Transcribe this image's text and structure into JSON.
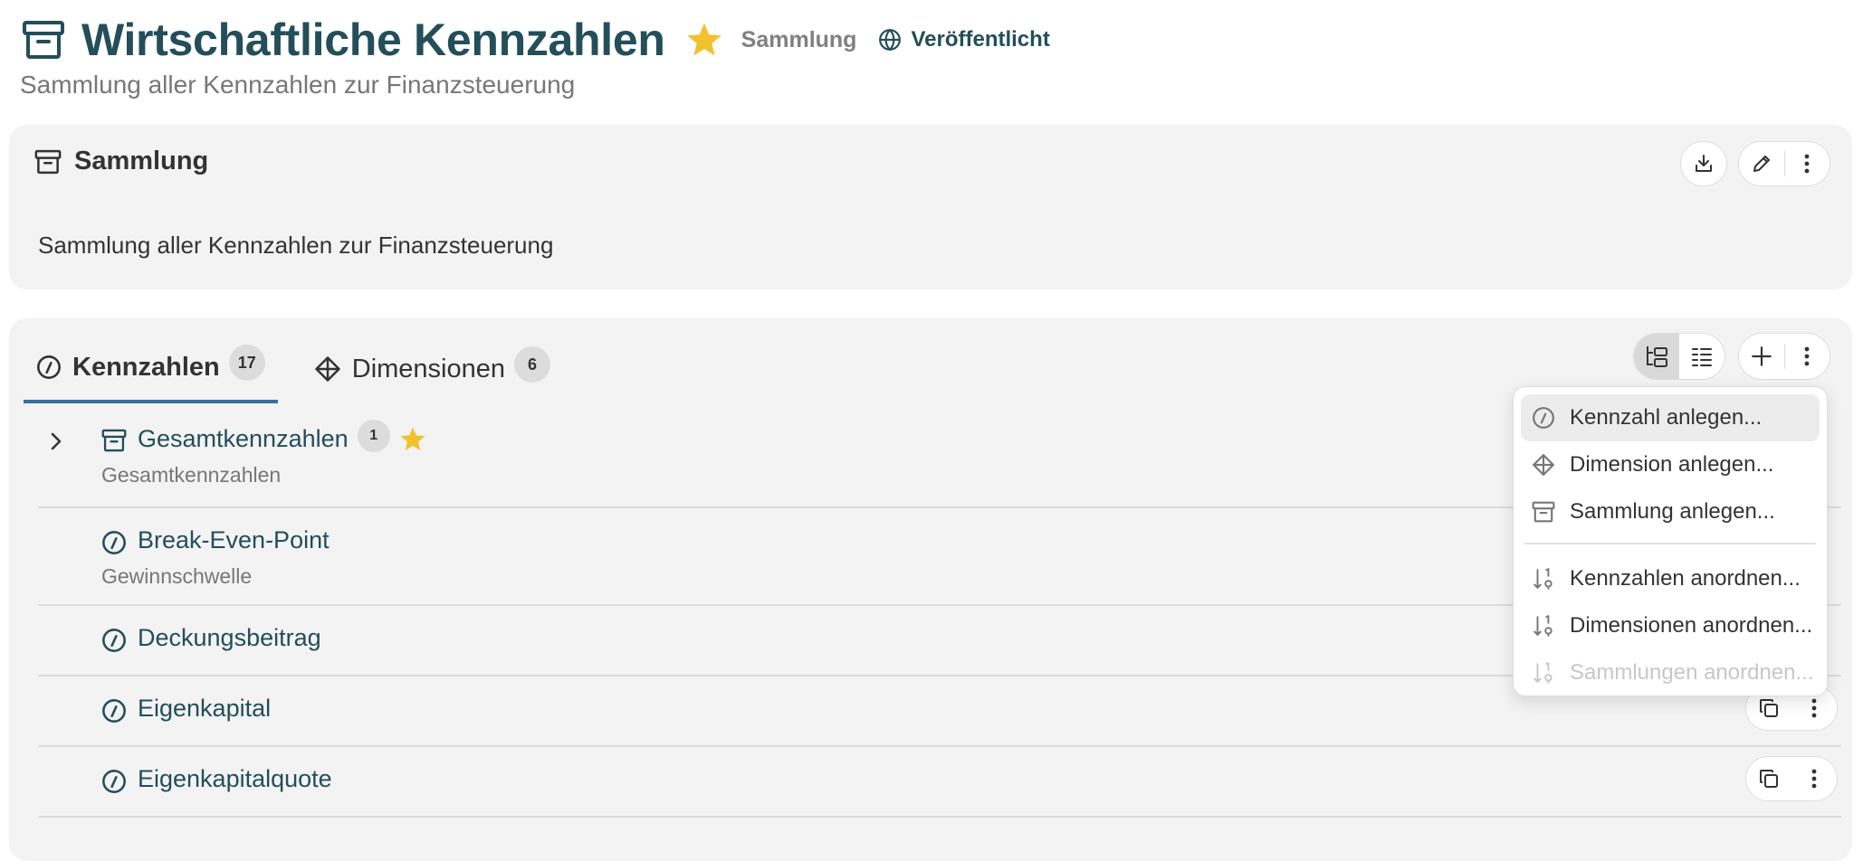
{
  "header": {
    "title": "Wirtschaftliche Kennzahlen",
    "type_label": "Sammlung",
    "status_label": "Veröffentlicht",
    "subtitle": "Sammlung aller Kennzahlen zur Finanzsteuerung"
  },
  "info_card": {
    "title": "Sammlung",
    "description": "Sammlung aller Kennzahlen zur Finanzsteuerung"
  },
  "tabs": [
    {
      "label": "Kennzahlen",
      "count": "17",
      "active": true
    },
    {
      "label": "Dimensionen",
      "count": "6",
      "active": false
    }
  ],
  "list": [
    {
      "name": "Gesamtkennzahlen",
      "subtitle": "Gesamtkennzahlen",
      "count": "1",
      "kind": "collection",
      "favorite": true,
      "expandable": true
    },
    {
      "name": "Break-Even-Point",
      "subtitle": "Gewinnschwelle",
      "kind": "kpi"
    },
    {
      "name": "Deckungsbeitrag",
      "subtitle": "",
      "kind": "kpi"
    },
    {
      "name": "Eigenkapital",
      "subtitle": "",
      "kind": "kpi"
    },
    {
      "name": "Eigenkapitalquote",
      "subtitle": "",
      "kind": "kpi"
    }
  ],
  "menu": {
    "items": [
      {
        "label": "Kennzahl anlegen...",
        "icon": "gauge-icon",
        "state": "hover"
      },
      {
        "label": "Dimension anlegen...",
        "icon": "diamond-icon",
        "state": "normal"
      },
      {
        "label": "Sammlung anlegen...",
        "icon": "archive-icon",
        "state": "normal"
      },
      {
        "label": "Kennzahlen anordnen...",
        "icon": "sort-icon",
        "state": "normal"
      },
      {
        "label": "Dimensionen anordnen...",
        "icon": "sort-icon",
        "state": "normal"
      },
      {
        "label": "Sammlungen anordnen...",
        "icon": "sort-icon",
        "state": "disabled"
      }
    ]
  },
  "colors": {
    "accent": "#234e5a",
    "star": "#f2c12e",
    "tab_underline": "#3a6fa0",
    "card_bg": "#f3f3f3"
  }
}
